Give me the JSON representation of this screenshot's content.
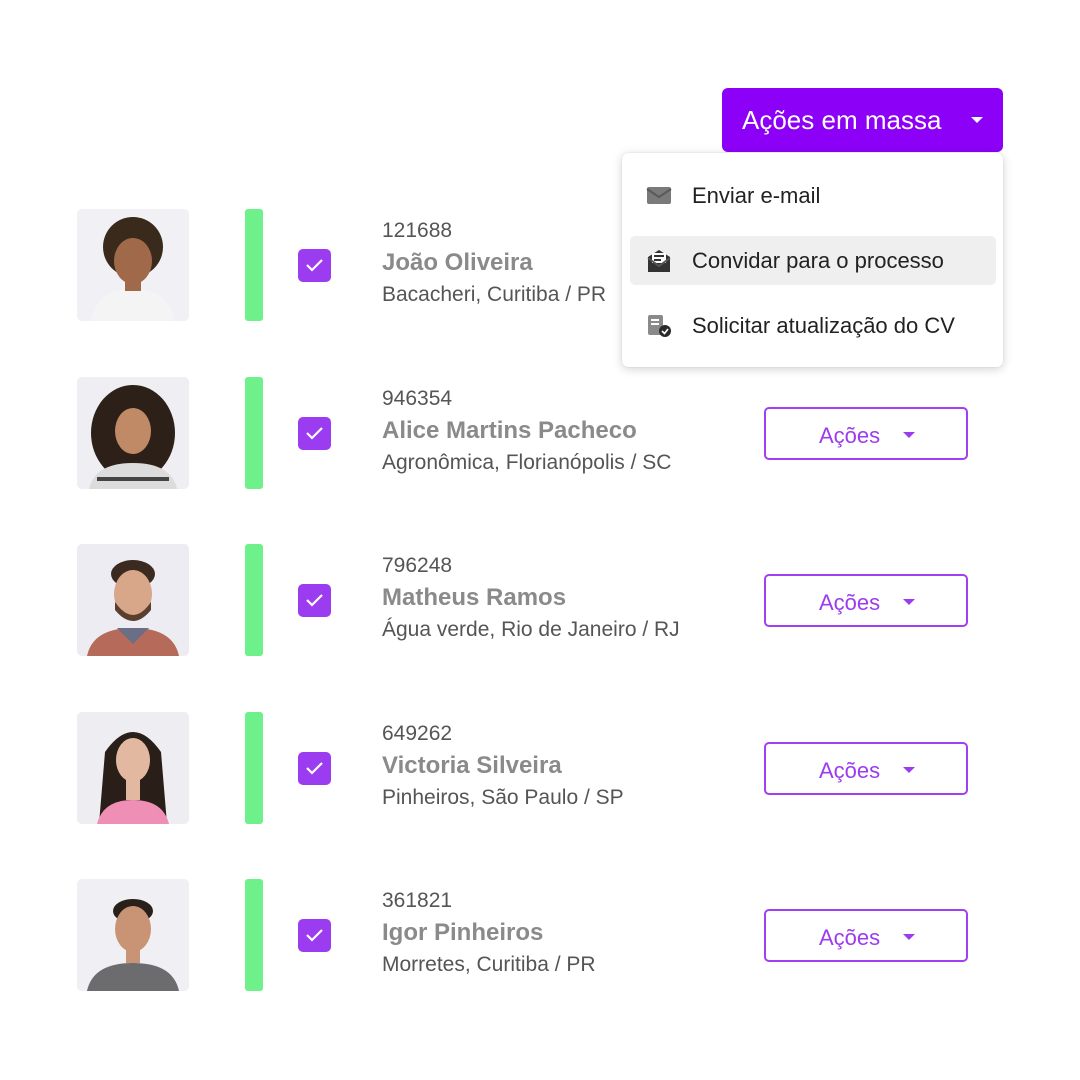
{
  "bulk_actions": {
    "label": "Ações em massa"
  },
  "menu": {
    "items": [
      {
        "label": "Enviar e-mail",
        "icon": "envelope-icon"
      },
      {
        "label": "Convidar para o processo",
        "icon": "invite-envelope-icon"
      },
      {
        "label": "Solicitar atualização do CV",
        "icon": "document-check-icon"
      }
    ],
    "highlighted_index": 1
  },
  "colors": {
    "accent": "#8c00f7",
    "checkbox": "#9b3cf0",
    "status": "#6ef08a"
  },
  "candidates": [
    {
      "id": "121688",
      "name": "João Oliveira",
      "location": "Bacacheri, Curitiba / PR",
      "checked": true,
      "actions_label": ""
    },
    {
      "id": "946354",
      "name": "Alice Martins Pacheco",
      "location": "Agronômica, Florianópolis / SC",
      "checked": true,
      "actions_label": "Ações"
    },
    {
      "id": "796248",
      "name": "Matheus Ramos",
      "location": "Água verde, Rio de Janeiro / RJ",
      "checked": true,
      "actions_label": "Ações"
    },
    {
      "id": "649262",
      "name": "Victoria Silveira",
      "location": "Pinheiros, São Paulo / SP",
      "checked": true,
      "actions_label": "Ações"
    },
    {
      "id": "361821",
      "name": "Igor Pinheiros",
      "location": "Morretes, Curitiba / PR",
      "checked": true,
      "actions_label": "Ações"
    }
  ]
}
